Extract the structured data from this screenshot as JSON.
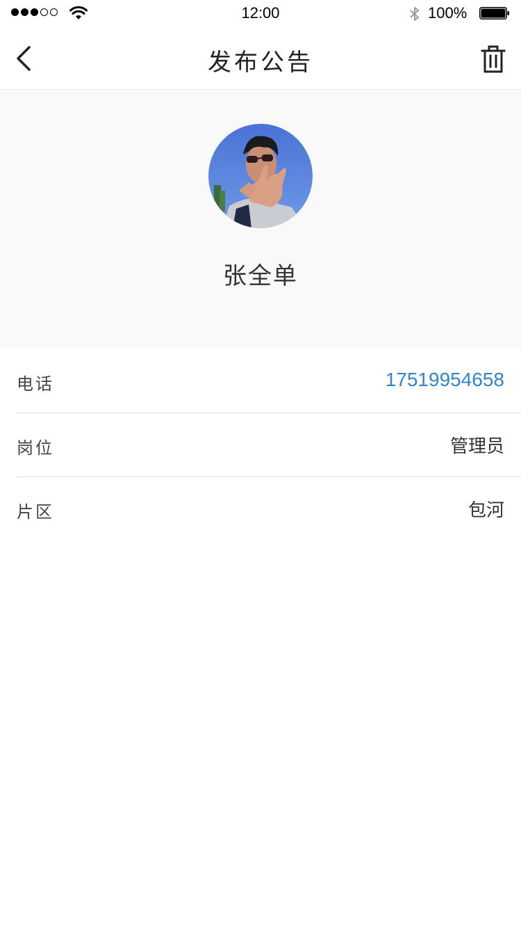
{
  "status_bar": {
    "signal_filled": 3,
    "signal_total": 5,
    "time": "12:00",
    "battery_percent": "100%",
    "battery_level": 1.0
  },
  "nav": {
    "title": "发布公告",
    "back_icon": "chevron-left-icon",
    "action_icon": "trash-icon"
  },
  "profile": {
    "name": "张全单",
    "avatar_icon": "avatar-photo"
  },
  "info": {
    "rows": [
      {
        "label": "电话",
        "value": "17519954658"
      },
      {
        "label": "岗位",
        "value": "管理员"
      },
      {
        "label": "片区",
        "value": "包河"
      }
    ]
  },
  "colors": {
    "link": "#2f86cc",
    "header_bg": "#f9f9f9",
    "divider": "#dddddd"
  }
}
